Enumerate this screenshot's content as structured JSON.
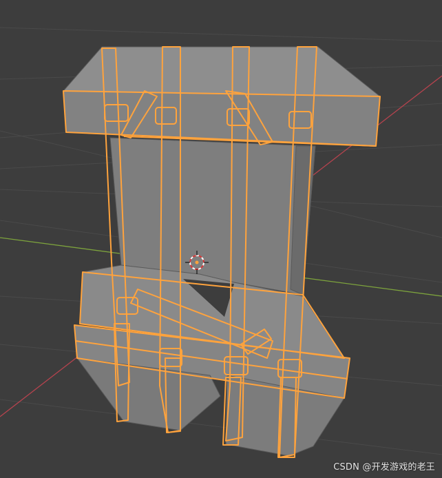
{
  "viewport": {
    "background": "#3d3d3d",
    "grid_color": "#4a4a4a",
    "axis_x_color": "#b5434e",
    "axis_y_color": "#7da33d",
    "selection_color": "#ffa33d",
    "mesh_color": "#8a8a8a",
    "cursor_icon": "3d-cursor-icon"
  },
  "watermark": {
    "text": "CSDN @开发游戏的老王"
  }
}
